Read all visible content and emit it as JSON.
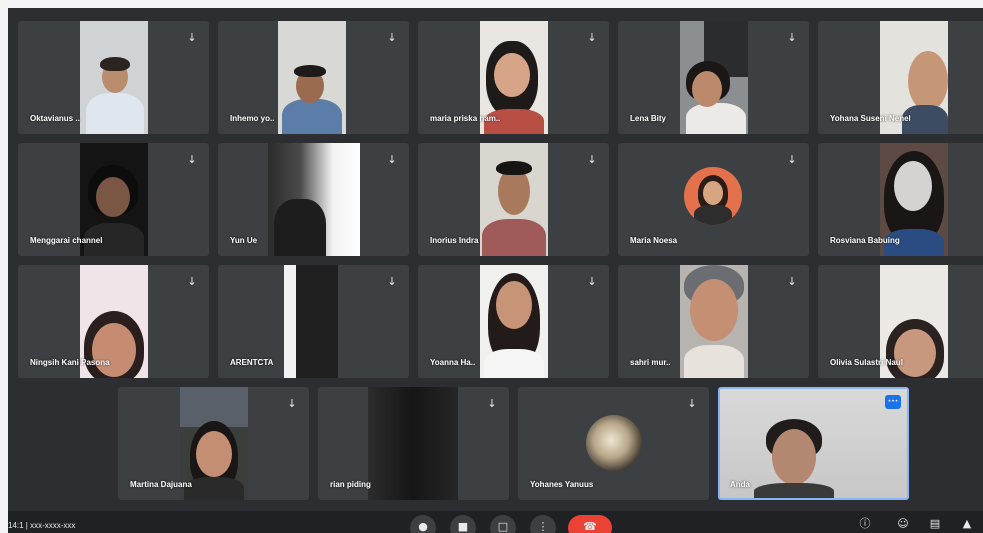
{
  "participants": [
    {
      "name": "Oktavianus .."
    },
    {
      "name": "Inhemo yo.."
    },
    {
      "name": "maria priska nam.."
    },
    {
      "name": "Lena Bity"
    },
    {
      "name": "Yohana Suseni Nenel"
    },
    {
      "name": "Menggarai channel"
    },
    {
      "name": "Yun Ue"
    },
    {
      "name": "Inorius Indra"
    },
    {
      "name": "Maria Noesa"
    },
    {
      "name": "Rosviana Babuing"
    },
    {
      "name": "Ningsih Kani Pasona"
    },
    {
      "name": "ARENTCTA"
    },
    {
      "name": "Yoanna Ha.."
    },
    {
      "name": "sahri mur.."
    },
    {
      "name": "Olivia Sulastri Naul"
    },
    {
      "name": "Martina Dajuana"
    },
    {
      "name": "rian piding"
    },
    {
      "name": "Yohanes Yanuus"
    },
    {
      "name": "Anda"
    }
  ],
  "self_badge": "•••",
  "icons": {
    "mic": "mic-off-icon",
    "controls": [
      "mic-icon",
      "camera-icon",
      "present-icon",
      "more-icon",
      "end-call-icon"
    ]
  },
  "bottom": {
    "meeting_info": "14:1 | xxx-xxxx-xxx"
  },
  "colors": {
    "background": "#2d2e31",
    "tile": "#3c4043",
    "end_call": "#ea4335",
    "active_border": "#8ab4f8"
  }
}
